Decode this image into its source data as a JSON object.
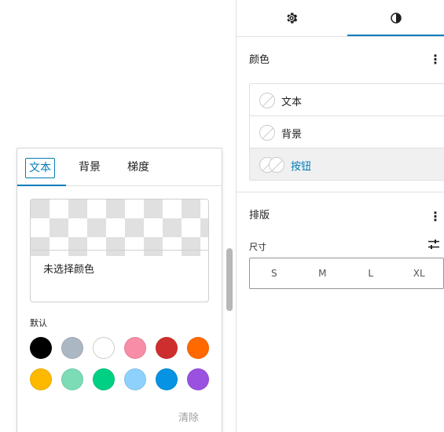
{
  "popover": {
    "tabs": [
      {
        "label": "文本",
        "active": true
      },
      {
        "label": "背景",
        "active": false
      },
      {
        "label": "梯度",
        "active": false
      }
    ],
    "preview": {
      "no_color_text": "未选择颜色"
    },
    "palette_label": "默认",
    "swatches": [
      {
        "name": "black",
        "color": "#000000"
      },
      {
        "name": "cyan-bluish-gray",
        "color": "#abb8c3"
      },
      {
        "name": "white",
        "color": "#ffffff"
      },
      {
        "name": "pale-pink",
        "color": "#f78da7"
      },
      {
        "name": "vivid-red",
        "color": "#cf2e2e"
      },
      {
        "name": "luminous-vivid-orange",
        "color": "#ff6900"
      },
      {
        "name": "luminous-vivid-amber",
        "color": "#fcb900"
      },
      {
        "name": "light-green-cyan",
        "color": "#7bdcb5"
      },
      {
        "name": "vivid-green-cyan",
        "color": "#00d084"
      },
      {
        "name": "pale-cyan-blue",
        "color": "#8ed1fc"
      },
      {
        "name": "vivid-cyan-blue",
        "color": "#0693e3"
      },
      {
        "name": "vivid-purple",
        "color": "#9b51e0"
      }
    ],
    "clear_label": "清除"
  },
  "sidebar": {
    "tabs": [
      {
        "icon": "gear-icon",
        "active": false
      },
      {
        "icon": "half-circle-icon",
        "active": true
      }
    ],
    "color_section": {
      "title": "颜色",
      "items": [
        {
          "label": "文本",
          "selected": false
        },
        {
          "label": "背景",
          "selected": false
        },
        {
          "label": "按钮",
          "selected": true
        }
      ]
    },
    "typography_section": {
      "title": "排版",
      "size_label": "尺寸",
      "sizes": [
        "S",
        "M",
        "L",
        "XL"
      ]
    }
  },
  "colors": {
    "accent": "#007cba",
    "text": "#1e1e1e"
  }
}
